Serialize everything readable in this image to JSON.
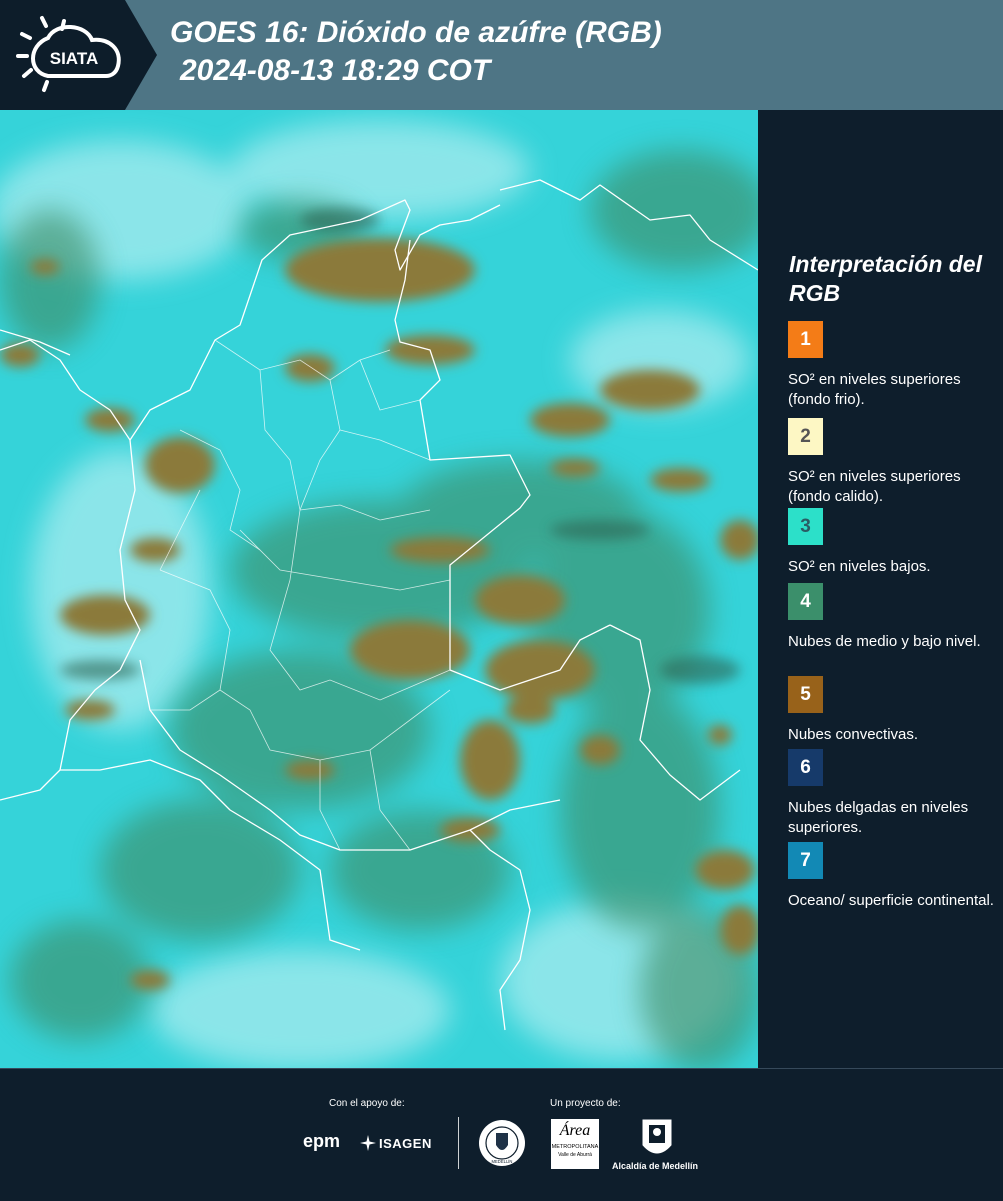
{
  "header": {
    "logo_text": "SIATA",
    "title_line1": "GOES 16: Dióxido de azúfre (RGB)",
    "title_line2": "2024-08-13 18:29 COT"
  },
  "legend": {
    "title": "Interpretación del RGB",
    "items": [
      {
        "number": "1",
        "color": "#f47c17",
        "number_color": "#ffffff",
        "text": "SO² en niveles superiores (fondo frio)."
      },
      {
        "number": "2",
        "color": "#fdf7c4",
        "number_color": "#555555",
        "text": "SO² en niveles superiores (fondo calido)."
      },
      {
        "number": "3",
        "color": "#2ce0c9",
        "number_color": "#2a5d64",
        "text": "SO² en niveles bajos."
      },
      {
        "number": "4",
        "color": "#3b8f6b",
        "number_color": "#ffffff",
        "text": "Nubes de medio y bajo nivel."
      },
      {
        "number": "5",
        "color": "#98621a",
        "number_color": "#ffffff",
        "text": "Nubes convectivas."
      },
      {
        "number": "6",
        "color": "#163a6a",
        "number_color": "#ffffff",
        "text": "Nubes delgadas en niveles superiores."
      },
      {
        "number": "7",
        "color": "#1289b5",
        "number_color": "#ffffff",
        "text": "Oceano/ superficie continental."
      }
    ]
  },
  "footer": {
    "support_label": "Con el apoyo de:",
    "project_label": "Un proyecto de:",
    "sponsor1": "epm",
    "sponsor2": "ISAGEN",
    "partner1_line1": "Área",
    "partner1_line2": "METROPOLITANA",
    "partner1_line3": "Valle de Aburrá",
    "partner2": "Alcaldía de Medellín",
    "seal_text": "MEDELLÍN"
  },
  "map": {
    "background_color": "#35d3d9",
    "cloud_color": "#8a7a3c",
    "vegetation_color": "#3c8a62",
    "border_color": "#ffffff"
  }
}
